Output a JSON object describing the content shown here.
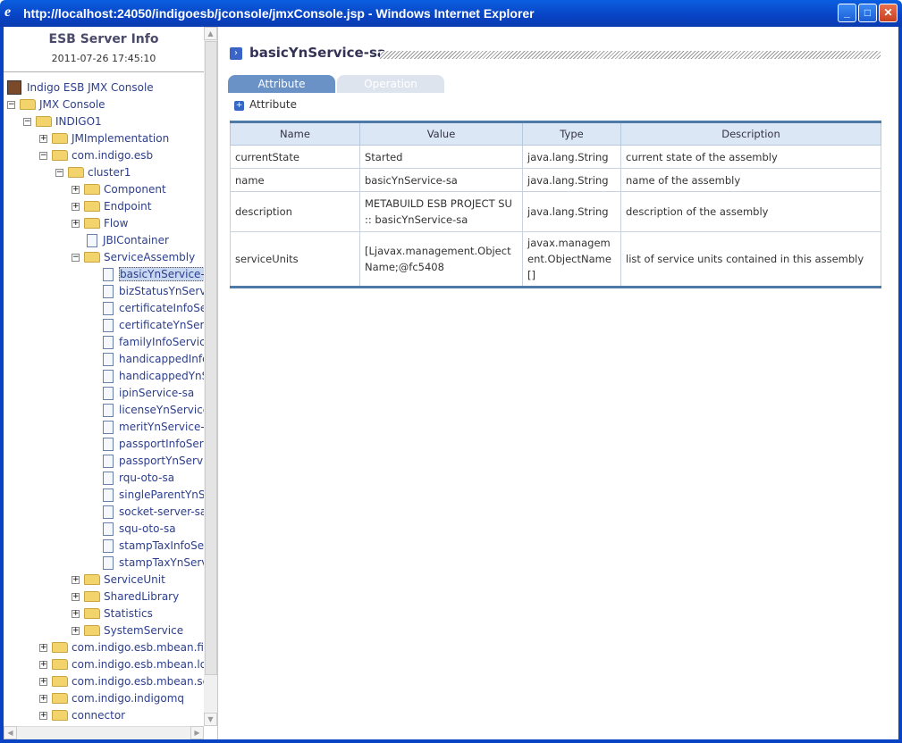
{
  "window": {
    "title": "http://localhost:24050/indigoesb/jconsole/jmxConsole.jsp - Windows Internet Explorer"
  },
  "sidebar": {
    "title": "ESB Server Info",
    "datetime": "2011-07-26 17:45:10",
    "tree": [
      {
        "label": "Indigo ESB JMX Console",
        "level": 0,
        "kind": "root"
      },
      {
        "label": "JMX Console",
        "level": 0,
        "kind": "folder",
        "expander": "-"
      },
      {
        "label": "INDIGO1",
        "level": 1,
        "kind": "folder",
        "expander": "-"
      },
      {
        "label": "JMImplementation",
        "level": 2,
        "kind": "folder",
        "expander": "+"
      },
      {
        "label": "com.indigo.esb",
        "level": 2,
        "kind": "folder",
        "expander": "-"
      },
      {
        "label": "cluster1",
        "level": 3,
        "kind": "folder",
        "expander": "-"
      },
      {
        "label": "Component",
        "level": 4,
        "kind": "folder",
        "expander": "+"
      },
      {
        "label": "Endpoint",
        "level": 4,
        "kind": "folder",
        "expander": "+"
      },
      {
        "label": "Flow",
        "level": 4,
        "kind": "folder",
        "expander": "+"
      },
      {
        "label": "JBIContainer",
        "level": 4,
        "kind": "file"
      },
      {
        "label": "ServiceAssembly",
        "level": 4,
        "kind": "folder",
        "expander": "-"
      },
      {
        "label": "basicYnService-sa",
        "level": 5,
        "kind": "file",
        "selected": true
      },
      {
        "label": "bizStatusYnServic",
        "level": 5,
        "kind": "file"
      },
      {
        "label": "certificateInfoSer",
        "level": 5,
        "kind": "file"
      },
      {
        "label": "certificateYnServ",
        "level": 5,
        "kind": "file"
      },
      {
        "label": "familyInfoService-",
        "level": 5,
        "kind": "file"
      },
      {
        "label": "handicappedInfoS",
        "level": 5,
        "kind": "file"
      },
      {
        "label": "handicappedYnSe",
        "level": 5,
        "kind": "file"
      },
      {
        "label": "ipinService-sa",
        "level": 5,
        "kind": "file"
      },
      {
        "label": "licenseYnService-",
        "level": 5,
        "kind": "file"
      },
      {
        "label": "meritYnService-sa",
        "level": 5,
        "kind": "file"
      },
      {
        "label": "passportInfoServi",
        "level": 5,
        "kind": "file"
      },
      {
        "label": "passportYnServic",
        "level": 5,
        "kind": "file"
      },
      {
        "label": "rqu-oto-sa",
        "level": 5,
        "kind": "file"
      },
      {
        "label": "singleParentYnSe",
        "level": 5,
        "kind": "file"
      },
      {
        "label": "socket-server-sa",
        "level": 5,
        "kind": "file"
      },
      {
        "label": "squ-oto-sa",
        "level": 5,
        "kind": "file"
      },
      {
        "label": "stampTaxInfoServ",
        "level": 5,
        "kind": "file"
      },
      {
        "label": "stampTaxYnServic",
        "level": 5,
        "kind": "file"
      },
      {
        "label": "ServiceUnit",
        "level": 4,
        "kind": "folder",
        "expander": "+"
      },
      {
        "label": "SharedLibrary",
        "level": 4,
        "kind": "folder",
        "expander": "+"
      },
      {
        "label": "Statistics",
        "level": 4,
        "kind": "folder",
        "expander": "+"
      },
      {
        "label": "SystemService",
        "level": 4,
        "kind": "folder",
        "expander": "+"
      },
      {
        "label": "com.indigo.esb.mbean.file",
        "level": 2,
        "kind": "folder",
        "expander": "+"
      },
      {
        "label": "com.indigo.esb.mbean.log",
        "level": 2,
        "kind": "folder",
        "expander": "+"
      },
      {
        "label": "com.indigo.esb.mbean.serv",
        "level": 2,
        "kind": "folder",
        "expander": "+"
      },
      {
        "label": "com.indigo.indigomq",
        "level": 2,
        "kind": "folder",
        "expander": "+"
      },
      {
        "label": "connector",
        "level": 2,
        "kind": "folder",
        "expander": "+"
      }
    ]
  },
  "main": {
    "title": "basicYnService-sa",
    "tabs": [
      {
        "label": "Attribute",
        "active": true
      },
      {
        "label": "Operation",
        "active": false
      }
    ],
    "section": "Attribute",
    "table": {
      "columns": [
        "Name",
        "Value",
        "Type",
        "Description"
      ],
      "rows": [
        [
          "currentState",
          "Started",
          "java.lang.String",
          "current state of the assembly"
        ],
        [
          "name",
          "basicYnService-sa",
          "java.lang.String",
          "name of the assembly"
        ],
        [
          "description",
          "METABUILD ESB PROJECT SU :: basicYnService-sa",
          "java.lang.String",
          "description of the assembly"
        ],
        [
          "serviceUnits",
          "[Ljavax.management.ObjectName;@fc5408",
          "javax.management.ObjectName[]",
          "list of service units contained in this assembly"
        ]
      ]
    }
  }
}
